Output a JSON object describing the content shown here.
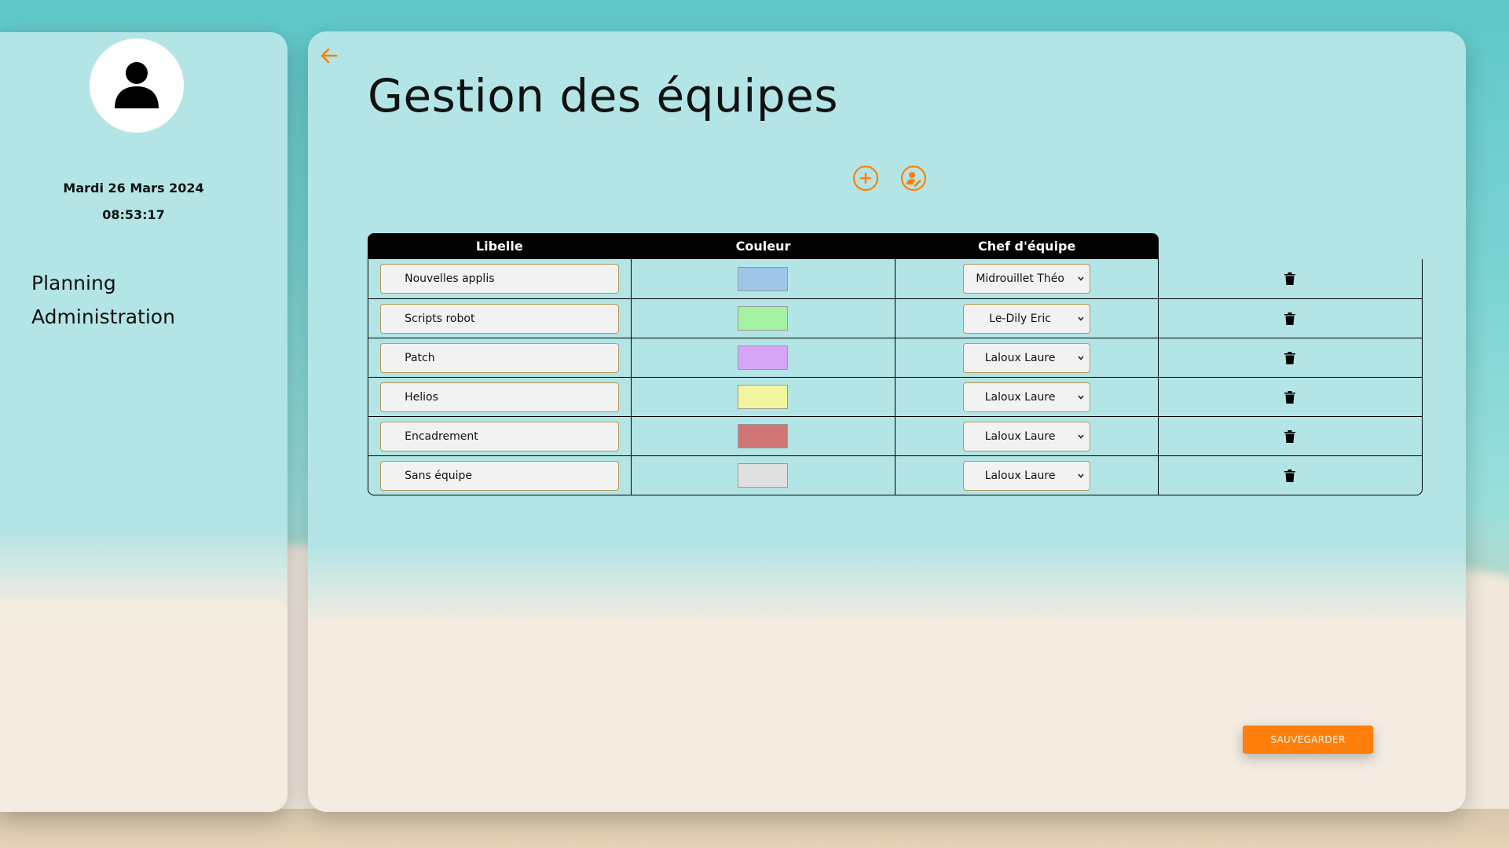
{
  "sidebar": {
    "date": "Mardi 26 Mars 2024",
    "time": "08:53:17",
    "nav": [
      {
        "label": "Planning"
      },
      {
        "label": "Administration"
      }
    ]
  },
  "main": {
    "title": "Gestion des équipes",
    "table": {
      "headers": [
        "Libelle",
        "Couleur",
        "Chef d'équipe"
      ],
      "rows": [
        {
          "libelle": "Nouvelles applis",
          "color": "#9fc6e8",
          "chef": "Midrouillet Théo"
        },
        {
          "libelle": "Scripts robot",
          "color": "#a5f2a4",
          "chef": "Le-Dily Eric"
        },
        {
          "libelle": "Patch",
          "color": "#d6a5f5",
          "chef": "Laloux Laure"
        },
        {
          "libelle": "Helios",
          "color": "#f3f59e",
          "chef": "Laloux Laure"
        },
        {
          "libelle": "Encadrement",
          "color": "#cf7575",
          "chef": "Laloux Laure"
        },
        {
          "libelle": "Sans équipe",
          "color": "#e0e0e0",
          "chef": "Laloux Laure"
        }
      ]
    },
    "save_label": "SAUVEGARDER"
  },
  "colors": {
    "accent": "#ff7f0a",
    "card": "#b4e5e6",
    "sand": "#f4ece1"
  },
  "icons": [
    "user-avatar-icon",
    "back-arrow-icon",
    "add-circle-icon",
    "user-edit-icon",
    "trash-icon",
    "chevron-down-icon"
  ]
}
